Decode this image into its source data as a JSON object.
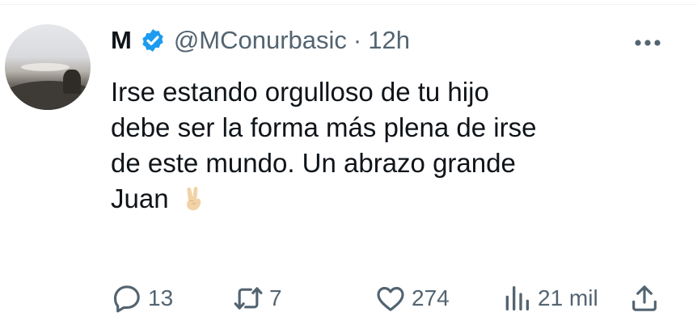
{
  "author": {
    "name": "M",
    "handle": "@MConurbasic",
    "separator": "·",
    "time": "12h",
    "verified": true
  },
  "tweet": {
    "lines": [
      "Irse estando orgulloso de tu hijo",
      "debe ser la forma más plena de irse",
      "de este mundo. Un abrazo grande",
      "Juan"
    ],
    "emoji": "victory-hand"
  },
  "actions": {
    "replies": "13",
    "retweets": "7",
    "likes": "274",
    "views": "21 mil"
  },
  "icons": {
    "more": "more-horizontal-icon",
    "reply": "reply-icon",
    "retweet": "retweet-icon",
    "like": "heart-icon",
    "views": "views-icon",
    "share": "share-icon"
  },
  "colors": {
    "text": "#0f1419",
    "secondary": "#536471",
    "verified": "#1d9bf0",
    "background": "#ffffff"
  }
}
